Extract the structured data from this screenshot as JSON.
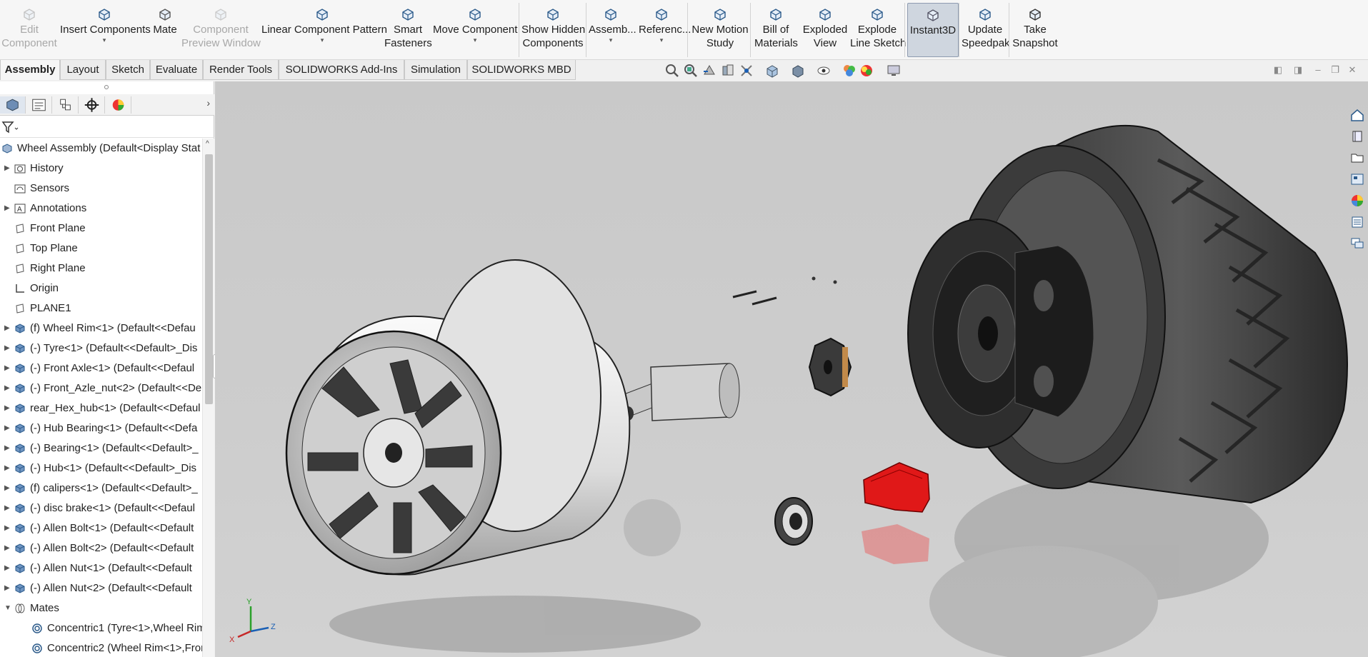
{
  "ribbon": {
    "items": [
      {
        "label1": "Edit",
        "label2": "Component",
        "disabled": true
      },
      {
        "label1": "Insert Components",
        "label2": "",
        "dropdown": true
      },
      {
        "label1": "Mate",
        "label2": ""
      },
      {
        "label1": "Component",
        "label2": "Preview Window",
        "disabled": true
      },
      {
        "label1": "Linear Component Pattern",
        "label2": "",
        "dropdown": true
      },
      {
        "label1": "Smart",
        "label2": "Fasteners"
      },
      {
        "label1": "Move Component",
        "label2": "",
        "dropdown": true
      },
      {
        "label1": "Show Hidden",
        "label2": "Components"
      },
      {
        "label1": "Assemb...",
        "label2": "",
        "dropdown": true
      },
      {
        "label1": "Referenc...",
        "label2": "",
        "dropdown": true
      },
      {
        "label1": "New Motion",
        "label2": "Study"
      },
      {
        "label1": "Bill of",
        "label2": "Materials"
      },
      {
        "label1": "Exploded",
        "label2": "View"
      },
      {
        "label1": "Explode",
        "label2": "Line Sketch"
      },
      {
        "label1": "Instant3D",
        "label2": "",
        "active": true
      },
      {
        "label1": "Update",
        "label2": "Speedpak"
      },
      {
        "label1": "Take",
        "label2": "Snapshot"
      }
    ]
  },
  "tabs": [
    "Assembly",
    "Layout",
    "Sketch",
    "Evaluate",
    "Render Tools",
    "SOLIDWORKS Add-Ins",
    "Simulation",
    "SOLIDWORKS MBD"
  ],
  "active_tab": "Assembly",
  "tree": {
    "root": "Wheel Assembly  (Default<Display Stat",
    "items": [
      {
        "label": "History",
        "icon": "history-folder-icon",
        "expandable": true
      },
      {
        "label": "Sensors",
        "icon": "sensors-icon",
        "expandable": false
      },
      {
        "label": "Annotations",
        "icon": "annotations-icon",
        "expandable": true
      },
      {
        "label": "Front Plane",
        "icon": "plane-icon",
        "expandable": false
      },
      {
        "label": "Top Plane",
        "icon": "plane-icon",
        "expandable": false
      },
      {
        "label": "Right Plane",
        "icon": "plane-icon",
        "expandable": false
      },
      {
        "label": "Origin",
        "icon": "origin-icon",
        "expandable": false
      },
      {
        "label": "PLANE1",
        "icon": "plane-icon",
        "expandable": false
      },
      {
        "label": "(f) Wheel Rim<1> (Default<<Defau",
        "icon": "part-icon",
        "expandable": true
      },
      {
        "label": "(-) Tyre<1> (Default<<Default>_Dis",
        "icon": "part-icon",
        "expandable": true
      },
      {
        "label": "(-) Front Axle<1> (Default<<Defaul",
        "icon": "part-icon",
        "expandable": true
      },
      {
        "label": "(-) Front_Azle_nut<2> (Default<<De",
        "icon": "part-icon",
        "expandable": true
      },
      {
        "label": "rear_Hex_hub<1> (Default<<Defaul",
        "icon": "part-icon",
        "expandable": true
      },
      {
        "label": "(-) Hub Bearing<1> (Default<<Defa",
        "icon": "part-icon",
        "expandable": true
      },
      {
        "label": "(-) Bearing<1> (Default<<Default>_",
        "icon": "part-icon",
        "expandable": true
      },
      {
        "label": "(-) Hub<1> (Default<<Default>_Dis",
        "icon": "part-icon",
        "expandable": true
      },
      {
        "label": "(f) calipers<1> (Default<<Default>_",
        "icon": "part-icon",
        "expandable": true
      },
      {
        "label": "(-) disc brake<1> (Default<<Defaul",
        "icon": "part-icon",
        "expandable": true
      },
      {
        "label": "(-) Allen Bolt<1> (Default<<Default",
        "icon": "part-icon",
        "expandable": true
      },
      {
        "label": "(-) Allen Bolt<2> (Default<<Default",
        "icon": "part-icon",
        "expandable": true
      },
      {
        "label": "(-) Allen Nut<1> (Default<<Default",
        "icon": "part-icon",
        "expandable": true
      },
      {
        "label": "(-) Allen Nut<2> (Default<<Default",
        "icon": "part-icon",
        "expandable": true
      },
      {
        "label": "Mates",
        "icon": "mates-icon",
        "expandable": true,
        "expanded": true
      },
      {
        "label": "Concentric1 (Tyre<1>,Wheel Rim",
        "icon": "concentric-mate-icon",
        "expandable": false,
        "indent": true
      },
      {
        "label": "Concentric2 (Wheel Rim<1>,Fron",
        "icon": "concentric-mate-icon",
        "expandable": false,
        "indent": true
      }
    ]
  },
  "triad": {
    "x": "X",
    "y": "Y",
    "z": "Z"
  },
  "colors": {
    "caliper": "#e01818",
    "accent": "#1a5fb4"
  }
}
